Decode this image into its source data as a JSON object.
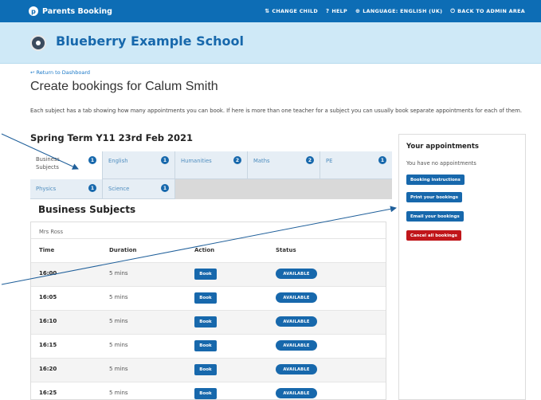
{
  "topbar": {
    "brand": "Parents Booking",
    "brand_icon": "p-logo-icon",
    "nav": [
      {
        "icon": "⇅",
        "label": "CHANGE CHILD"
      },
      {
        "icon": "?",
        "label": "HELP"
      },
      {
        "icon": "⊕",
        "label": "LANGUAGE: ENGLISH (UK)"
      },
      {
        "icon": "⏻",
        "label": "BACK TO ADMIN AREA"
      }
    ]
  },
  "school": {
    "name": "Blueberry Example School"
  },
  "back_link": "↩ Return to Dashboard",
  "page_title": "Create bookings for Calum Smith",
  "intro": "Each subject has a tab showing how many appointments you can book. If here is more than one teacher for a subject you can usually book separate appointments for each of them.",
  "term_title": "Spring Term Y11 23rd Feb 2021",
  "tabs": [
    {
      "label": "Business Subjects",
      "count": "1"
    },
    {
      "label": "English",
      "count": "1"
    },
    {
      "label": "Humanities",
      "count": "2"
    },
    {
      "label": "Maths",
      "count": "2"
    },
    {
      "label": "PE",
      "count": "1"
    },
    {
      "label": "Physics",
      "count": "1"
    },
    {
      "label": "Science",
      "count": "1"
    }
  ],
  "section_title": "Business Subjects",
  "table": {
    "teacher": "Mrs Ross",
    "headers": {
      "time": "Time",
      "duration": "Duration",
      "action": "Action",
      "status": "Status"
    },
    "rows": [
      {
        "time": "16:00",
        "duration": "5 mins",
        "action": "Book",
        "status": "AVAILABLE"
      },
      {
        "time": "16:05",
        "duration": "5 mins",
        "action": "Book",
        "status": "AVAILABLE"
      },
      {
        "time": "16:10",
        "duration": "5 mins",
        "action": "Book",
        "status": "AVAILABLE"
      },
      {
        "time": "16:15",
        "duration": "5 mins",
        "action": "Book",
        "status": "AVAILABLE"
      },
      {
        "time": "16:20",
        "duration": "5 mins",
        "action": "Book",
        "status": "AVAILABLE"
      },
      {
        "time": "16:25",
        "duration": "5 mins",
        "action": "Book",
        "status": "AVAILABLE"
      }
    ]
  },
  "side": {
    "title": "Your appointments",
    "empty": "You have no appointments",
    "buttons": {
      "instructions": "Booking instructions",
      "print": "Print your bookings",
      "email": "Email your bookings",
      "cancel": "Cancel all bookings"
    }
  },
  "colors": {
    "primary": "#1768ac",
    "topbar": "#0d6db5",
    "header_bg": "#cfe9f7",
    "danger": "#c0161a"
  }
}
